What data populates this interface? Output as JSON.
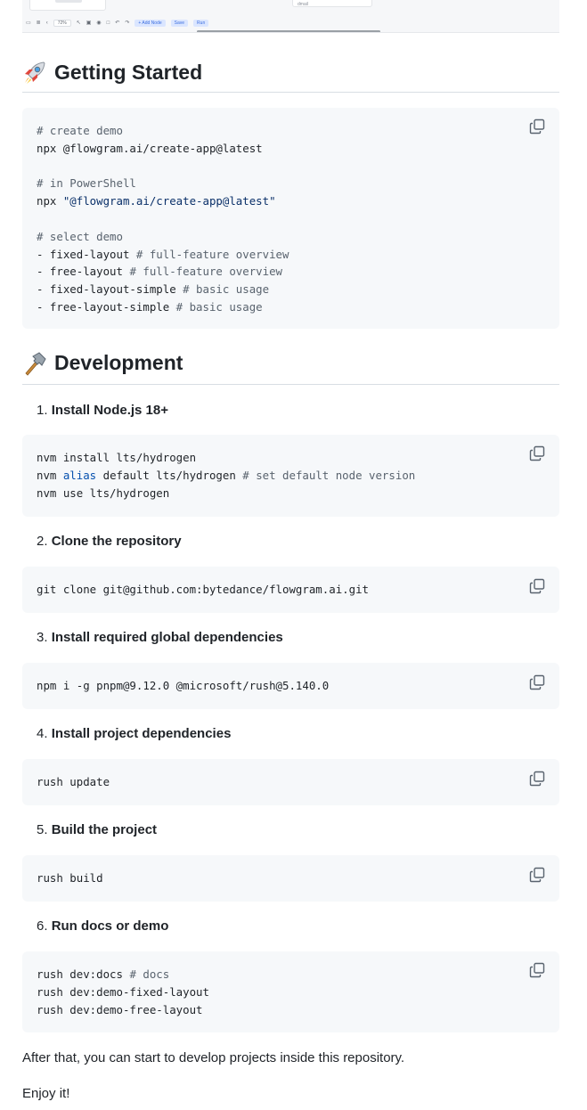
{
  "preview": {
    "zoom": "72%",
    "card_text": "dmail",
    "buttons": [
      "+ Add Node",
      "Save",
      "Run"
    ]
  },
  "getting_started": {
    "title": "Getting Started",
    "icon": "rocket-icon",
    "code": {
      "lines": [
        "# create demo",
        "npx @flowgram.ai/create-app@latest",
        "",
        "# in PowerShell",
        "npx \"@flowgram.ai/create-app@latest\"",
        "",
        "# select demo",
        "- fixed-layout # full-feature overview",
        "- free-layout # full-feature overview",
        "- fixed-layout-simple # basic usage",
        "- free-layout-simple # basic usage"
      ]
    }
  },
  "development": {
    "title": "Development",
    "icon": "hammer-icon",
    "steps": [
      {
        "num": "1.",
        "label": "Install Node.js 18+",
        "code": [
          "nvm install lts/hydrogen",
          "nvm alias default lts/hydrogen # set default node version",
          "nvm use lts/hydrogen"
        ]
      },
      {
        "num": "2.",
        "label": "Clone the repository",
        "code": [
          "git clone git@github.com:bytedance/flowgram.ai.git"
        ]
      },
      {
        "num": "3.",
        "label": "Install required global dependencies",
        "code": [
          "npm i -g pnpm@9.12.0 @microsoft/rush@5.140.0"
        ]
      },
      {
        "num": "4.",
        "label": "Install project dependencies",
        "code": [
          "rush update"
        ]
      },
      {
        "num": "5.",
        "label": "Build the project",
        "code": [
          "rush build"
        ]
      },
      {
        "num": "6.",
        "label": "Run docs or demo",
        "code": [
          "rush dev:docs # docs",
          "rush dev:demo-fixed-layout",
          "rush dev:demo-free-layout"
        ]
      }
    ]
  },
  "footer": {
    "after": "After that, you can start to develop projects inside this repository.",
    "enjoy": "Enjoy it!"
  },
  "colors": {
    "code_bg": "#f6f8fa",
    "comment": "#59636e",
    "string": "#0a3069",
    "keyword": "#0550ae"
  }
}
